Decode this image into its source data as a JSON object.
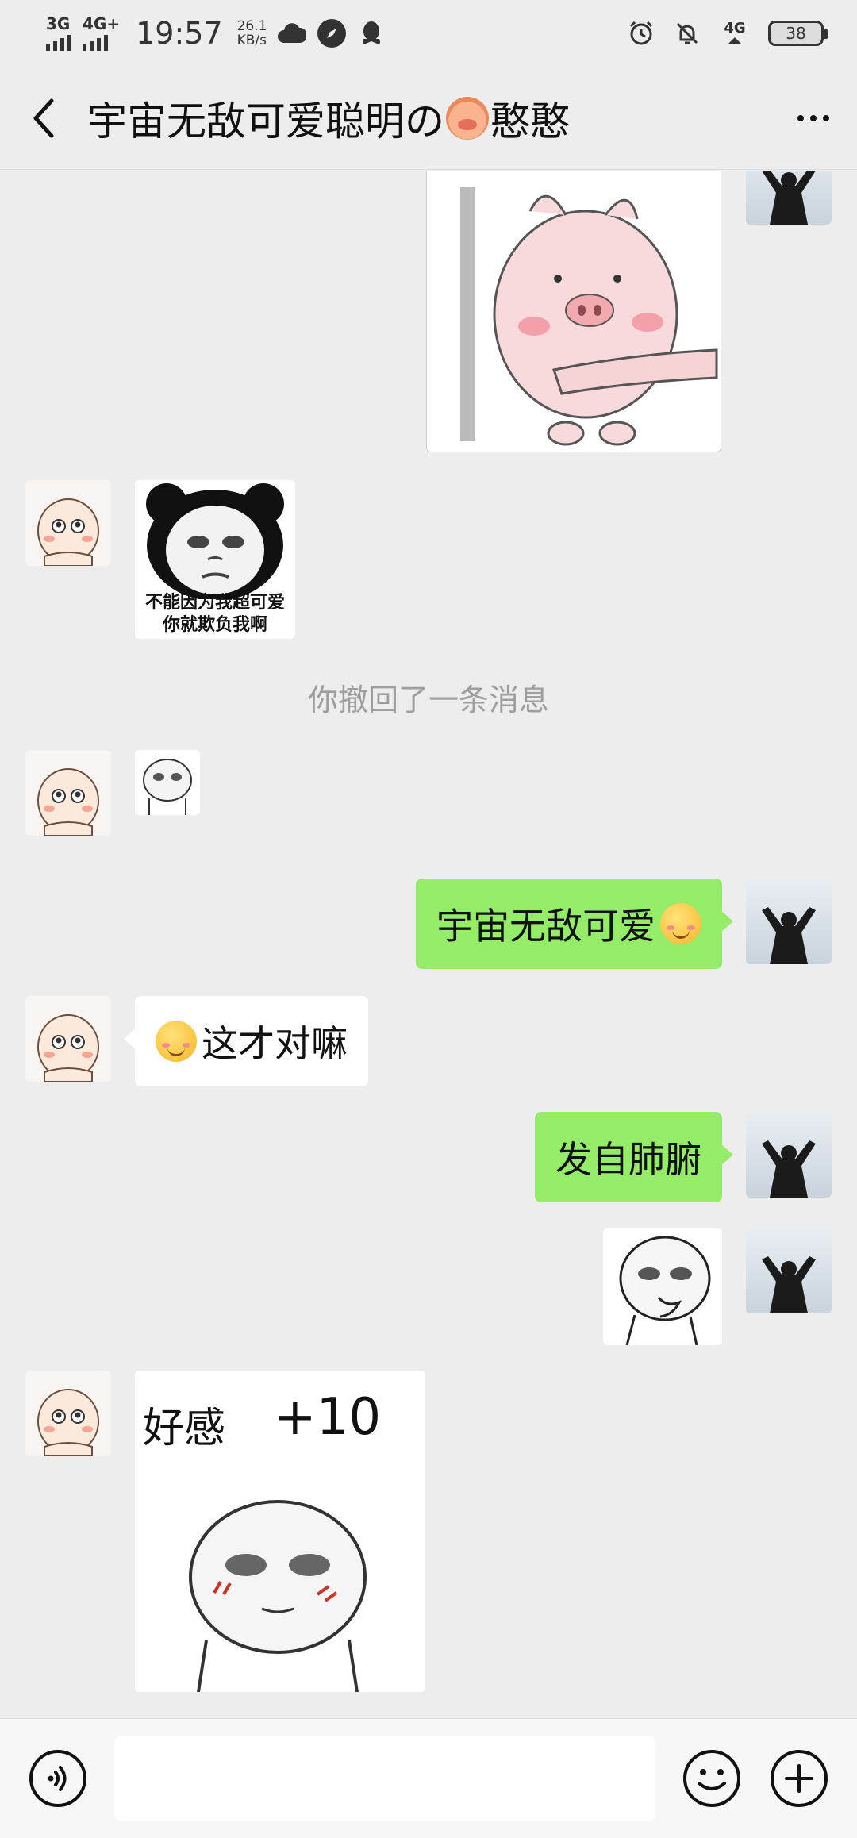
{
  "status_bar": {
    "network_1": "3G",
    "network_2": "4G+",
    "time": "19:57",
    "speed_value": "26.1",
    "speed_unit": "KB/s",
    "right_network": "4G",
    "battery": "38",
    "icons": [
      "cloud-icon",
      "compass-icon",
      "qq-icon",
      "alarm-icon",
      "mute-bell-icon",
      "signal-4g-icon",
      "battery-icon"
    ]
  },
  "navbar": {
    "title_prefix": "宇宙无敌可爱聪明の",
    "title_suffix": "憨憨"
  },
  "messages": {
    "sticker_panda_caption_1": "不能因为我超可爱",
    "sticker_panda_caption_2": "你就欺负我啊",
    "recall_notice": "你撤回了一条消息",
    "me_text_1": "宇宙无敌可爱",
    "them_text_1": "这才对嘛",
    "me_text_2": "发自肺腑",
    "sticker_last_caption": "好感",
    "sticker_last_plus": "+10"
  },
  "input_bar": {
    "placeholder": ""
  },
  "colors": {
    "background": "#ededed",
    "my_bubble": "#95ec69",
    "their_bubble": "#ffffff",
    "system_text": "#9e9e9e"
  }
}
